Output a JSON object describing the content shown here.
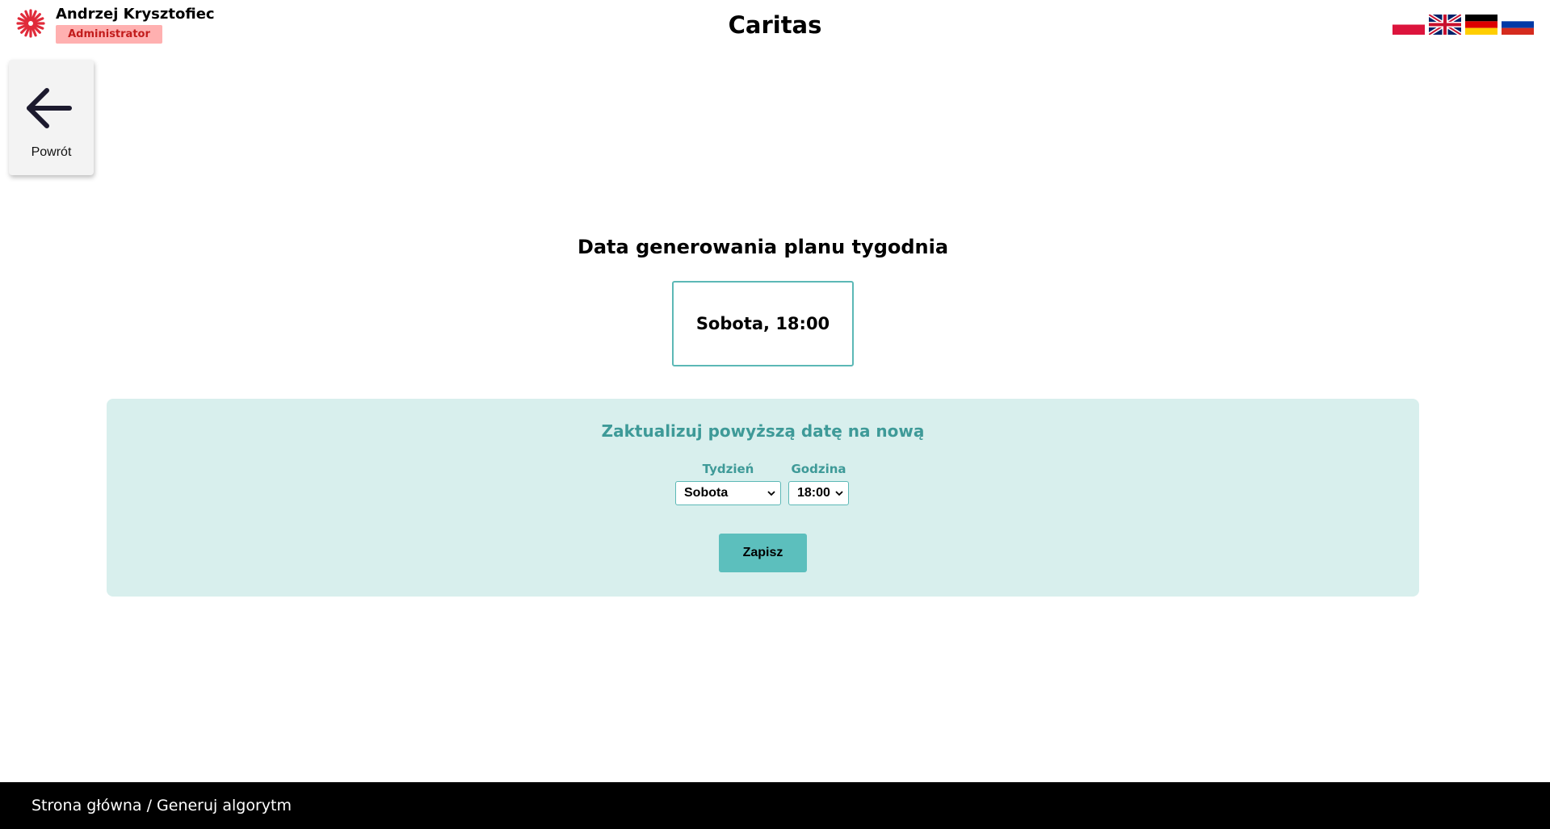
{
  "header": {
    "user_name": "Andrzej Krysztofiec",
    "role": "Administrator",
    "app_title": "Caritas",
    "languages": [
      "pl-flag-icon",
      "en-flag-icon",
      "de-flag-icon",
      "ru-flag-icon"
    ]
  },
  "back_button": {
    "label": "Powrót",
    "icon": "arrow-left-icon"
  },
  "main": {
    "section_title": "Data generowania planu tygodnia",
    "current_date": "Sobota, 18:00"
  },
  "update_panel": {
    "title": "Zaktualizuj powyższą datę na nową",
    "week_label": "Tydzień",
    "week_value": "Sobota",
    "hour_label": "Godzina",
    "hour_value": "18:00",
    "save_label": "Zapisz"
  },
  "footer": {
    "breadcrumb": "Strona główna / Generuj algorytm"
  },
  "colors": {
    "accent": "#5cb8b6",
    "panel_bg": "#d8efed",
    "role_badge_bg": "#ffb0b0",
    "role_badge_text": "#c21c1c",
    "footer_bg": "#000000"
  }
}
